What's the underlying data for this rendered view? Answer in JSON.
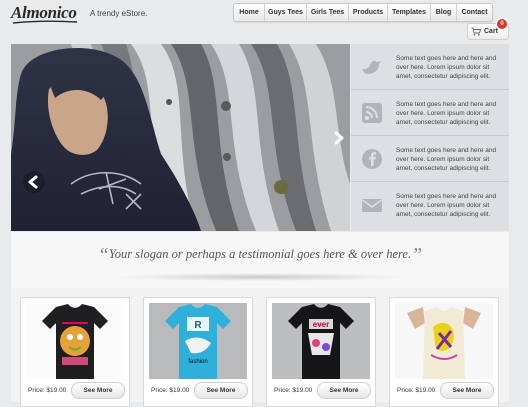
{
  "brand": {
    "logo": "Almonico",
    "tagline": "A trendy eStore."
  },
  "nav": [
    {
      "label": "Home"
    },
    {
      "label": "Guys Tees"
    },
    {
      "label": "Girls Tees"
    },
    {
      "label": "Products"
    },
    {
      "label": "Templates"
    },
    {
      "label": "Blog"
    },
    {
      "label": "Contact"
    }
  ],
  "cart": {
    "label": "Cart",
    "count": "0"
  },
  "side_items": [
    {
      "icon": "twitter-bird-icon",
      "text": "Some text goes here and here and over here. Lorem ipsum dolor sit amet, consectetur adipiscing elit."
    },
    {
      "icon": "rss-icon",
      "text": "Some text goes here and here and over here. Lorem ipsum dolor sit amet, consectetur adipiscing elit."
    },
    {
      "icon": "facebook-icon",
      "text": "Some text goes here and here and over here. Lorem ipsum dolor sit amet, consectetur adipiscing elit."
    },
    {
      "icon": "mail-icon",
      "text": "Some text goes here and here and over here. Lorem ipsum dolor sit amet, consectetur adipiscing elit."
    }
  ],
  "slogan": "Your slogan or perhaps a testimonial goes here & over here.",
  "products": [
    {
      "price": "Price: $19.00",
      "button": "See More",
      "image": "black-tee-cartoon-print"
    },
    {
      "price": "Price: $19.00",
      "button": "See More",
      "image": "blue-tee-fashion-print"
    },
    {
      "price": "Price: $19.00",
      "button": "See More",
      "image": "black-tee-graphic-print"
    },
    {
      "price": "Price: $19.00",
      "button": "See More",
      "image": "white-tee-yellow-print"
    }
  ],
  "colors": {
    "badge": "#d9332b",
    "page_bg": "#e9eaec",
    "panel_bg": "#dedfe2"
  }
}
